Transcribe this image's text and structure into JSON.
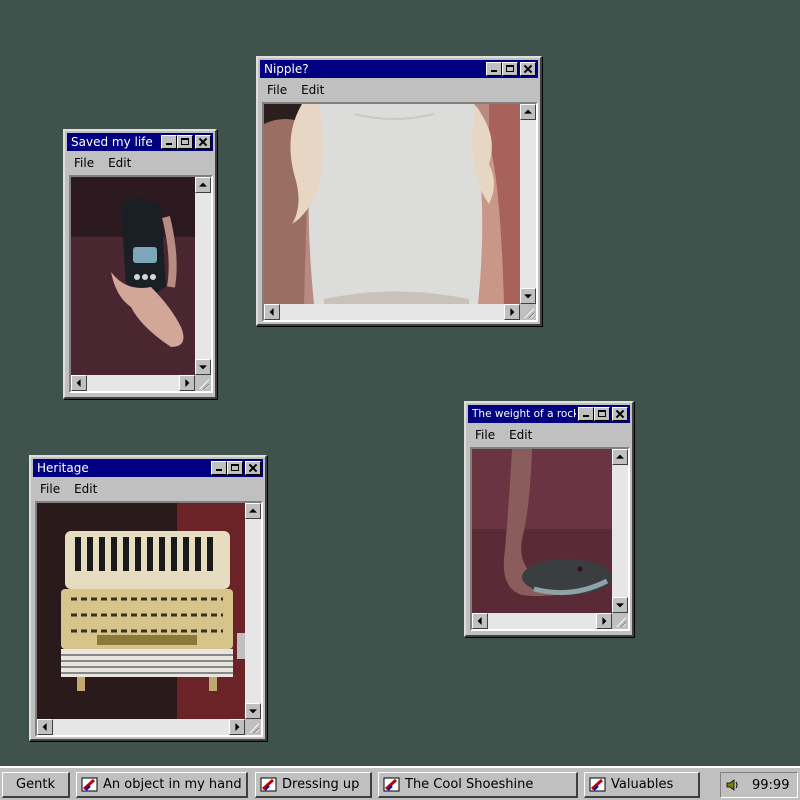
{
  "windows": [
    {
      "id": "nipple",
      "title": "Nipple?",
      "menu": [
        "File",
        "Edit"
      ]
    },
    {
      "id": "saved",
      "title": "Saved my life",
      "menu": [
        "File",
        "Edit"
      ]
    },
    {
      "id": "rock",
      "title": "The weight of a rock",
      "menu": [
        "File",
        "Edit"
      ]
    },
    {
      "id": "heritage",
      "title": "Heritage",
      "menu": [
        "File",
        "Edit"
      ]
    }
  ],
  "taskbar": {
    "start_label": "Gentk",
    "buttons": [
      "An object in my hand",
      "Dressing up",
      "The Cool Shoeshine",
      "Valuables"
    ],
    "clock": "99:99"
  },
  "colors": {
    "desktop": "#3f524b",
    "titlebar": "#000080",
    "chrome": "#c0c0c0"
  }
}
